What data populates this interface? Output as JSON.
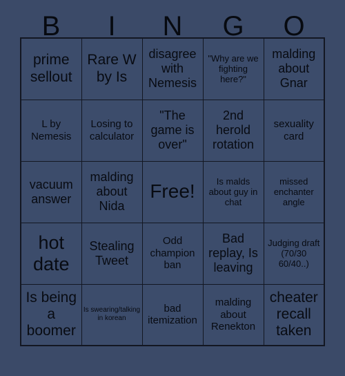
{
  "card": {
    "title": "BINGO",
    "background_color": "#3b4a68",
    "cell_color": "#3c4c6b",
    "border_color": "#131722",
    "text_color": "#080b12"
  },
  "header": {
    "letters": [
      "B",
      "I",
      "N",
      "G",
      "O"
    ]
  },
  "grid": {
    "columns": 5,
    "rows": 5,
    "cells": [
      [
        {
          "text": "prime sellout",
          "size": "fs-xl",
          "free": false
        },
        {
          "text": "Rare W by Is",
          "size": "fs-xl",
          "free": false
        },
        {
          "text": "disagree with Nemesis",
          "size": "fs-lg",
          "free": false
        },
        {
          "text": "\"Why are we fighting here?\"",
          "size": "fs-sm",
          "free": false
        },
        {
          "text": "malding about Gnar",
          "size": "fs-lg",
          "free": false
        }
      ],
      [
        {
          "text": "L by Nemesis",
          "size": "fs-md",
          "free": false
        },
        {
          "text": "Losing to calculator",
          "size": "fs-md",
          "free": false
        },
        {
          "text": "\"The game is over\"",
          "size": "fs-lg",
          "free": false
        },
        {
          "text": "2nd herold rotation",
          "size": "fs-lg",
          "free": false
        },
        {
          "text": "sexuality card",
          "size": "fs-md",
          "free": false
        }
      ],
      [
        {
          "text": "vacuum answer",
          "size": "fs-lg",
          "free": false
        },
        {
          "text": "malding about Nida",
          "size": "fs-lg",
          "free": false
        },
        {
          "text": "Free!",
          "size": "fs-free",
          "free": true
        },
        {
          "text": "Is malds about guy in chat",
          "size": "fs-sm",
          "free": false
        },
        {
          "text": "missed enchanter angle",
          "size": "fs-sm",
          "free": false
        }
      ],
      [
        {
          "text": "hot date",
          "size": "fs-xxl",
          "free": false
        },
        {
          "text": "Stealing Tweet",
          "size": "fs-lg",
          "free": false
        },
        {
          "text": "Odd champion ban",
          "size": "fs-md",
          "free": false
        },
        {
          "text": "Bad replay, Is leaving",
          "size": "fs-lg",
          "free": false
        },
        {
          "text": "Judging draft (70/30 60/40..)",
          "size": "fs-sm",
          "free": false
        }
      ],
      [
        {
          "text": "Is being a boomer",
          "size": "fs-xl",
          "free": false
        },
        {
          "text": "Is swearing/talking in korean",
          "size": "fs-xs",
          "free": false
        },
        {
          "text": "bad itemization",
          "size": "fs-md",
          "free": false
        },
        {
          "text": "malding about Renekton",
          "size": "fs-md",
          "free": false
        },
        {
          "text": "cheater recall taken",
          "size": "fs-xl",
          "free": false
        }
      ]
    ]
  }
}
